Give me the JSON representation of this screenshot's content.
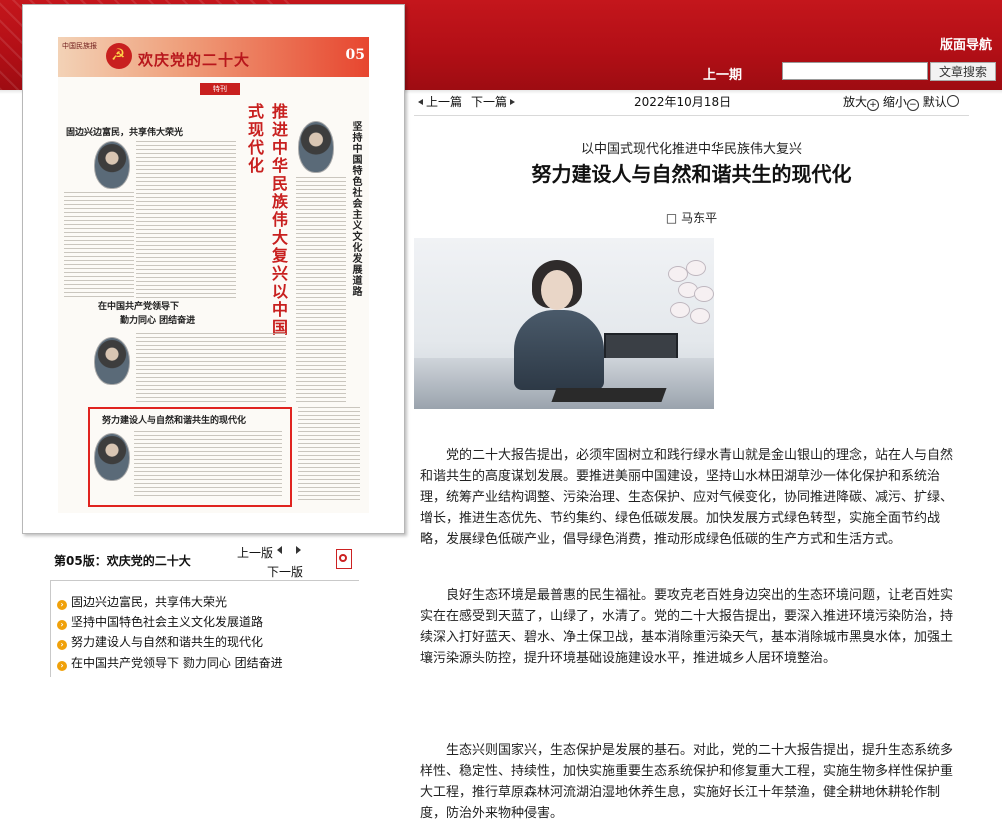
{
  "header": {
    "nav_title": "版面导航",
    "prev_period": "上一期",
    "search_placeholder": "",
    "search_button": "文章搜索"
  },
  "thumbnail": {
    "brand": "中国民族报",
    "banner_title": "欢庆党的二十大",
    "page_number": "05",
    "tag": "特刊",
    "headline_red": "推进中华民族伟大复兴以中国式现代化",
    "headline_black": "坚持中国特色社会主义文化发展道路",
    "col1_head": "固边兴边富民，共享伟大荣光",
    "col2_head_line1": "在中国共产党领导下",
    "col2_head_line2": "勤力同心 团结奋进",
    "col3_head": "努力建设人与自然和谐共生的现代化"
  },
  "sidebar": {
    "page_label": "第05版：欢庆党的二十大",
    "prev_page": "上一版",
    "next_page": "下一版",
    "pdf_icon": "pdf-icon",
    "articles": [
      "固边兴边富民，共享伟大荣光",
      "坚持中国特色社会主义文化发展道路",
      "努力建设人与自然和谐共生的现代化",
      "在中国共产党领导下 勠力同心 团结奋进"
    ]
  },
  "toolbar": {
    "prev_article": "上一篇",
    "next_article": "下一篇",
    "date": "2022年10月18日",
    "zoom_in": "放大",
    "zoom_out": "缩小",
    "default": "默认"
  },
  "article": {
    "subtitle": "以中国式现代化推进中华民族伟大复兴",
    "title": "努力建设人与自然和谐共生的现代化",
    "author": "□ 马东平",
    "paragraphs": [
      "党的二十大报告提出，必须牢固树立和践行绿水青山就是金山银山的理念，站在人与自然和谐共生的高度谋划发展。要推进美丽中国建设，坚持山水林田湖草沙一体化保护和系统治理，统筹产业结构调整、污染治理、生态保护、应对气候变化，协同推进降碳、减污、扩绿、增长，推进生态优先、节约集约、绿色低碳发展。加快发展方式绿色转型，实施全面节约战略，发展绿色低碳产业，倡导绿色消费，推动形成绿色低碳的生产方式和生活方式。",
      "良好生态环境是最普惠的民生福祉。要攻克老百姓身边突出的生态环境问题，让老百姓实实在在感受到天蓝了，山绿了，水清了。党的二十大报告提出，要深入推进环境污染防治，持续深入打好蓝天、碧水、净土保卫战，基本消除重污染天气，基本消除城市黑臭水体，加强土壤污染源头防控，提升环境基础设施建设水平，推进城乡人居环境整治。",
      "生态兴则国家兴，生态保护是发展的基石。对此，党的二十大报告提出，提升生态系统多样性、稳定性、持续性，加快实施重要生态系统保护和修复重大工程，实施生物多样性保护重大工程，推行草原森林河流湖泊湿地休养生息，实施好长江十年禁渔，健全耕地休耕轮作制度，防治外来物种侵害。"
    ]
  },
  "colors": {
    "header_red": "#b30f16",
    "bullet_orange": "#f0a10a",
    "highlight_red": "#e0231f"
  }
}
